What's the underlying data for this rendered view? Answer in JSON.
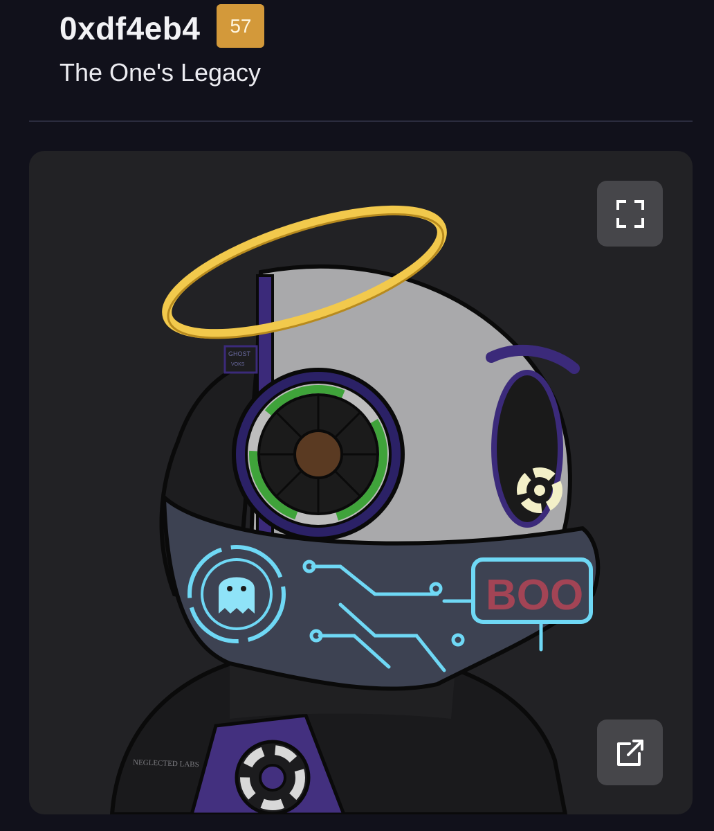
{
  "header": {
    "title": "0xdf4eb4",
    "badge": "57",
    "subtitle": "The One's Legacy"
  },
  "artwork": {
    "mask_text": "BOO",
    "jacket_text": "NEGLECTED LABS",
    "ear_text": "GHOST",
    "ear_subtext": "VOKS"
  },
  "actions": {
    "expand_icon": "fullscreen-icon",
    "open_icon": "external-link-icon"
  },
  "colors": {
    "background": "#11111b",
    "badge": "#d3993a",
    "card": "#222225",
    "halo": "#f2c94c",
    "accent_cyan": "#6fd8f5",
    "accent_purple": "#3b2a7a"
  }
}
